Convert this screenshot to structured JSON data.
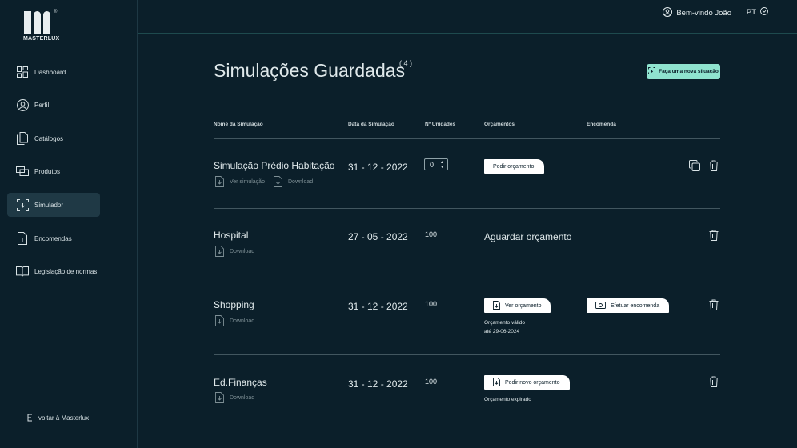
{
  "brand": {
    "name": "MASTERLUX",
    "reg": "®"
  },
  "sidebar": {
    "items": [
      {
        "label": "Dashboard",
        "icon": "dashboard-icon"
      },
      {
        "label": "Perfil",
        "icon": "user-circle-icon"
      },
      {
        "label": "Catálogos",
        "icon": "documents-icon"
      },
      {
        "label": "Produtos",
        "icon": "products-icon"
      },
      {
        "label": "Simulador",
        "icon": "simulator-icon",
        "active": true
      },
      {
        "label": "Encomendas",
        "icon": "order-icon"
      },
      {
        "label": "Legislação de normas",
        "icon": "book-icon"
      }
    ],
    "back_label": "voltar à Masterlux"
  },
  "header": {
    "greeting": "Bem-vindo João",
    "language": "PT"
  },
  "page": {
    "title": "Simulações Guardadas",
    "count": "( 4 )",
    "new_button": "Faça uma nova siluação"
  },
  "table": {
    "headers": {
      "name": "Nome da Simulação",
      "date": "Data da Simulação",
      "units": "Nº Unidades",
      "quotes": "Orçamentos",
      "order": "Encomenda"
    },
    "rows": [
      {
        "name": "Simulação Prédio Habitação",
        "date": "31 - 12 - 2022",
        "units": "0",
        "view_label": "Ver simulação",
        "download_label": "Download",
        "quote_button": "Pedir orçamento"
      },
      {
        "name": "Hospital",
        "date": "27 - 05 - 2022",
        "units": "100",
        "download_label": "Download",
        "quote_status": "Aguardar orçamento"
      },
      {
        "name": "Shopping",
        "date": "31 - 12 - 2022",
        "units": "100",
        "download_label": "Download",
        "quote_button": "Ver orçamento",
        "quote_note_1": "Orçamento válido",
        "quote_note_2": "até 29-06-2024",
        "order_button": "Efetuar encomenda"
      },
      {
        "name": "Ed.Finanças",
        "date": "31 - 12 - 2022",
        "units": "100",
        "download_label": "Download",
        "quote_button": "Pedir novo orçamento",
        "quote_note_1": "Orçamento expirado"
      }
    ]
  },
  "colors": {
    "background": "#0b1f2a",
    "accent": "#8fe3cf",
    "active_nav": "#1f3945",
    "divider": "#42565f"
  }
}
